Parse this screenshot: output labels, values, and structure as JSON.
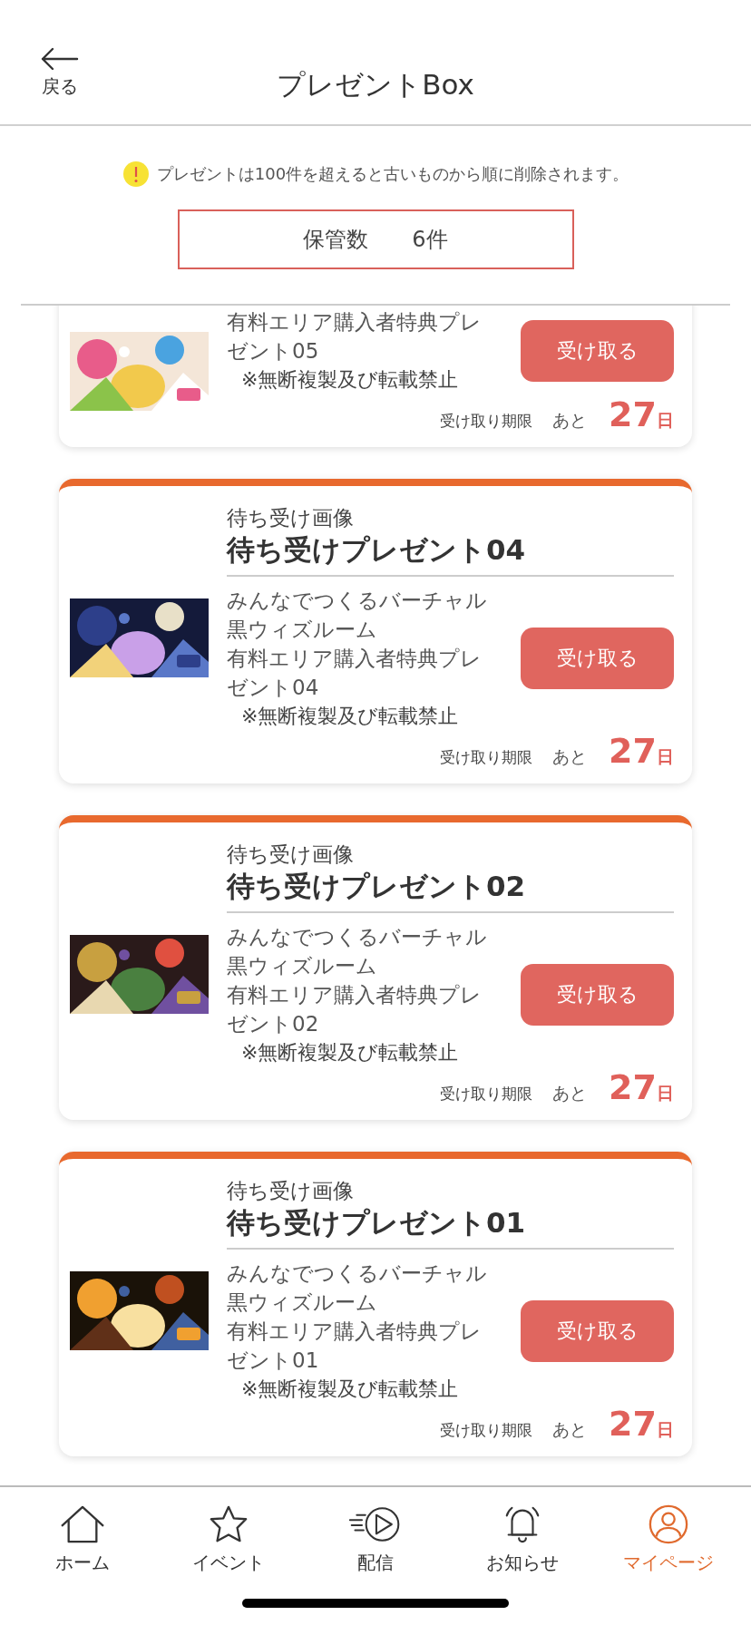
{
  "header": {
    "back_label": "戻る",
    "title": "プレゼントBox"
  },
  "notice": "プレゼントは100件を超えると古いものから順に削除されます。",
  "storage": {
    "label": "保管数",
    "count": "6件"
  },
  "presents": [
    {
      "description": [
        "有料エリア購入者特典プレゼント05"
      ],
      "note": "※無断複製及び転載禁止",
      "button": "受け取る",
      "expiry_label": "受け取り期限",
      "remaining_prefix": "あと",
      "days": "27",
      "days_unit": "日"
    },
    {
      "category": "待ち受け画像",
      "title": "待ち受けプレゼント04",
      "description": [
        "みんなでつくるバーチャル黒ウィズルーム",
        "有料エリア購入者特典プレゼント04"
      ],
      "note": "※無断複製及び転載禁止",
      "button": "受け取る",
      "expiry_label": "受け取り期限",
      "remaining_prefix": "あと",
      "days": "27",
      "days_unit": "日"
    },
    {
      "category": "待ち受け画像",
      "title": "待ち受けプレゼント02",
      "description": [
        "みんなでつくるバーチャル黒ウィズルーム",
        "有料エリア購入者特典プレゼント02"
      ],
      "note": "※無断複製及び転載禁止",
      "button": "受け取る",
      "expiry_label": "受け取り期限",
      "remaining_prefix": "あと",
      "days": "27",
      "days_unit": "日"
    },
    {
      "category": "待ち受け画像",
      "title": "待ち受けプレゼント01",
      "description": [
        "みんなでつくるバーチャル黒ウィズルーム",
        "有料エリア購入者特典プレゼント01"
      ],
      "note": "※無断複製及び転載禁止",
      "button": "受け取る",
      "expiry_label": "受け取り期限",
      "remaining_prefix": "あと",
      "days": "27",
      "days_unit": "日"
    }
  ],
  "nav": [
    {
      "kind": "home",
      "label": "ホーム",
      "selected": false
    },
    {
      "kind": "star",
      "label": "イベント",
      "selected": false
    },
    {
      "kind": "play",
      "label": "配信",
      "selected": false
    },
    {
      "kind": "bell",
      "label": "お知らせ",
      "selected": false
    },
    {
      "kind": "user",
      "label": "マイページ",
      "selected": true
    }
  ]
}
